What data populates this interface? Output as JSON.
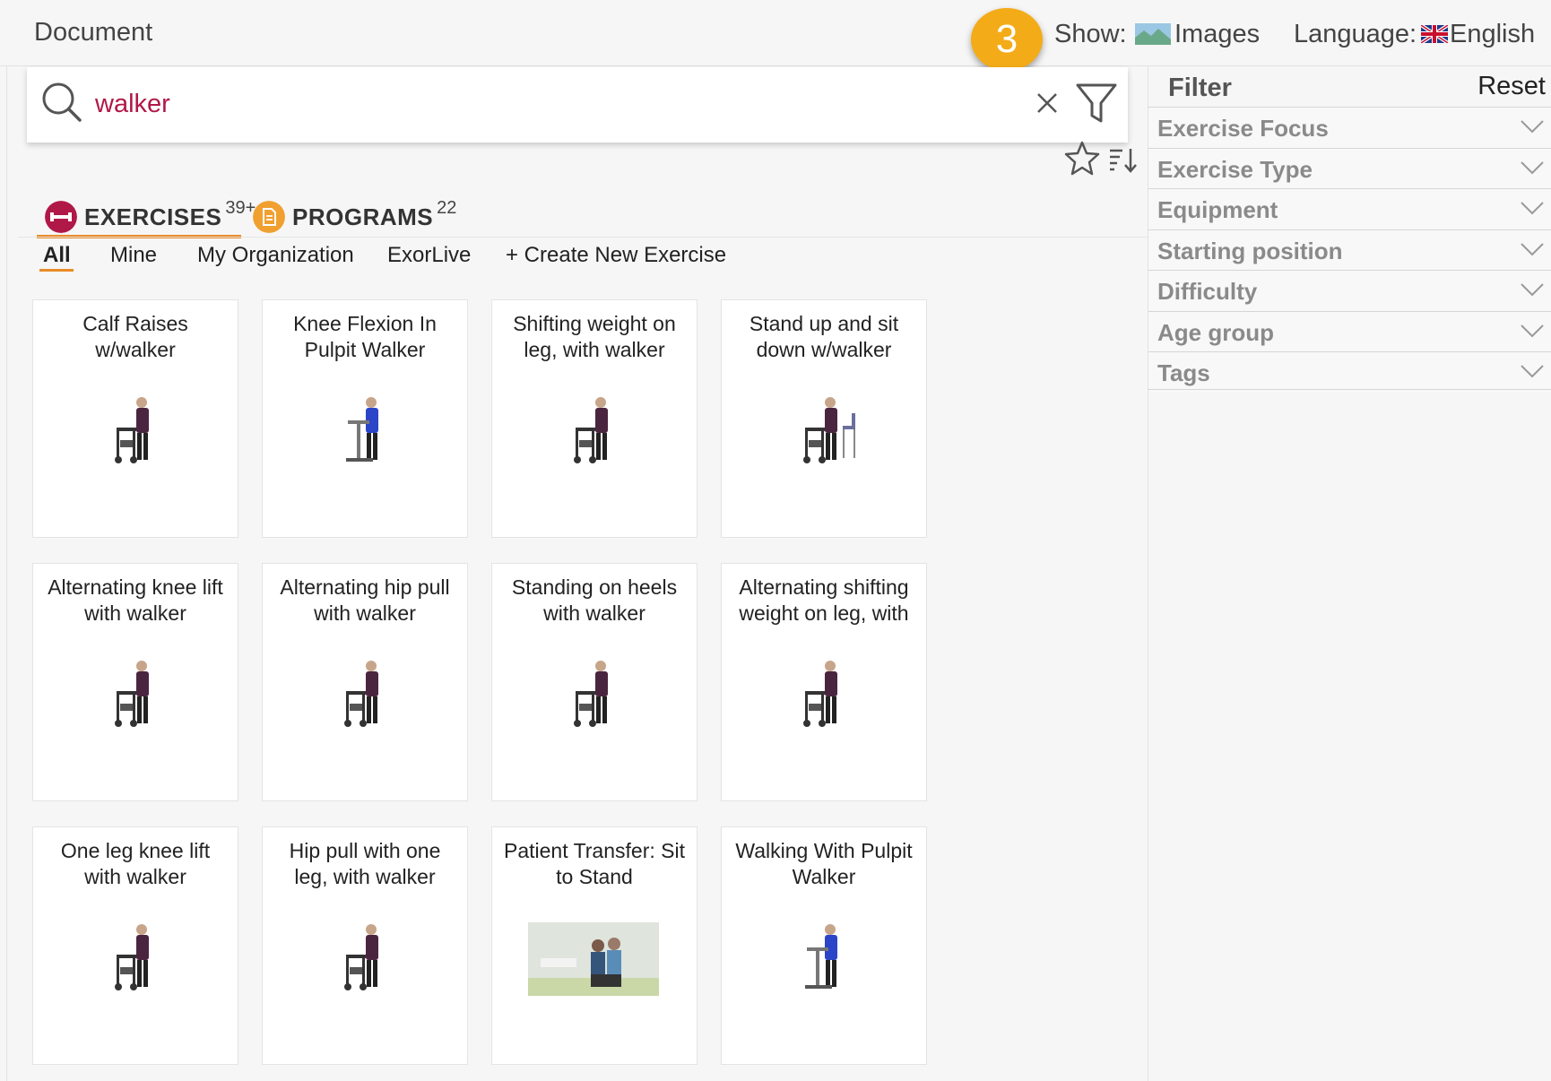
{
  "header": {
    "title": "Document",
    "step_number": "3",
    "show_label": "Show:",
    "show_value": "Images",
    "language_label": "Language:",
    "language_value": "English"
  },
  "search": {
    "query": "walker",
    "accent_color": "#b01848"
  },
  "tabs": [
    {
      "label": "EXERCISES",
      "count": "39+",
      "color": "#b01848",
      "icon": "dumbbell-icon"
    },
    {
      "label": "PROGRAMS",
      "count": "22",
      "color": "#f0a030",
      "icon": "document-icon"
    }
  ],
  "subtabs": [
    "All",
    "Mine",
    "My Organization",
    "ExorLive",
    "+ Create New Exercise"
  ],
  "exercises": [
    {
      "title": "Calf Raises w/walker"
    },
    {
      "title": "Knee Flexion In Pulpit Walker"
    },
    {
      "title": "Shifting weight on leg, with walker"
    },
    {
      "title": "Stand up and sit down w/walker"
    },
    {
      "title": "Alternating knee lift with walker"
    },
    {
      "title": "Alternating hip pull with walker"
    },
    {
      "title": "Standing on heels with walker"
    },
    {
      "title": "Alternating shifting weight on leg, with"
    },
    {
      "title": "One leg knee lift with walker"
    },
    {
      "title": "Hip pull with one leg, with walker"
    },
    {
      "title": "Patient Transfer: Sit to Stand"
    },
    {
      "title": "Walking With Pulpit Walker"
    }
  ],
  "filter": {
    "title": "Filter",
    "reset": "Reset",
    "items": [
      "Exercise Focus",
      "Exercise Type",
      "Equipment",
      "Starting position",
      "Difficulty",
      "Age group",
      "Tags"
    ]
  },
  "colors": {
    "badge": "#f4ab18",
    "tab_underline": "#e98b2a",
    "background": "#f6f6f6"
  }
}
